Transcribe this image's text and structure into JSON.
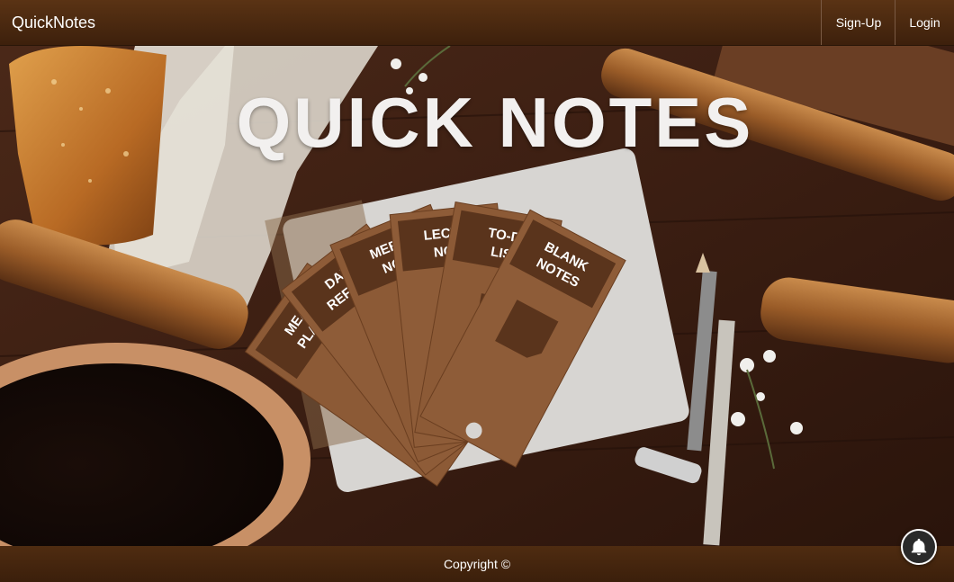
{
  "navbar": {
    "brand": "QuickNotes",
    "links": [
      {
        "label": "Sign-Up"
      },
      {
        "label": "Login"
      }
    ]
  },
  "hero": {
    "title": "QUICK NOTES",
    "cards": [
      {
        "label_line1": "MEA",
        "label_line2": "PLAN"
      },
      {
        "label_line1": "DAIL",
        "label_line2": "REFLEC"
      },
      {
        "label_line1": "MEETI",
        "label_line2": "NOT"
      },
      {
        "label_line1": "LECTU",
        "label_line2": "NOT"
      },
      {
        "label_line1": "TO-D",
        "label_line2": "LIS"
      },
      {
        "label_line1": "BLANK",
        "label_line2": "NOTES"
      }
    ]
  },
  "footer": {
    "copyright": "Copyright ©"
  },
  "colors": {
    "nav_bg": "#4a2a10",
    "card": "#8a5a36",
    "card_tab": "#5a341c"
  },
  "icons": {
    "notification": "bell-icon"
  }
}
